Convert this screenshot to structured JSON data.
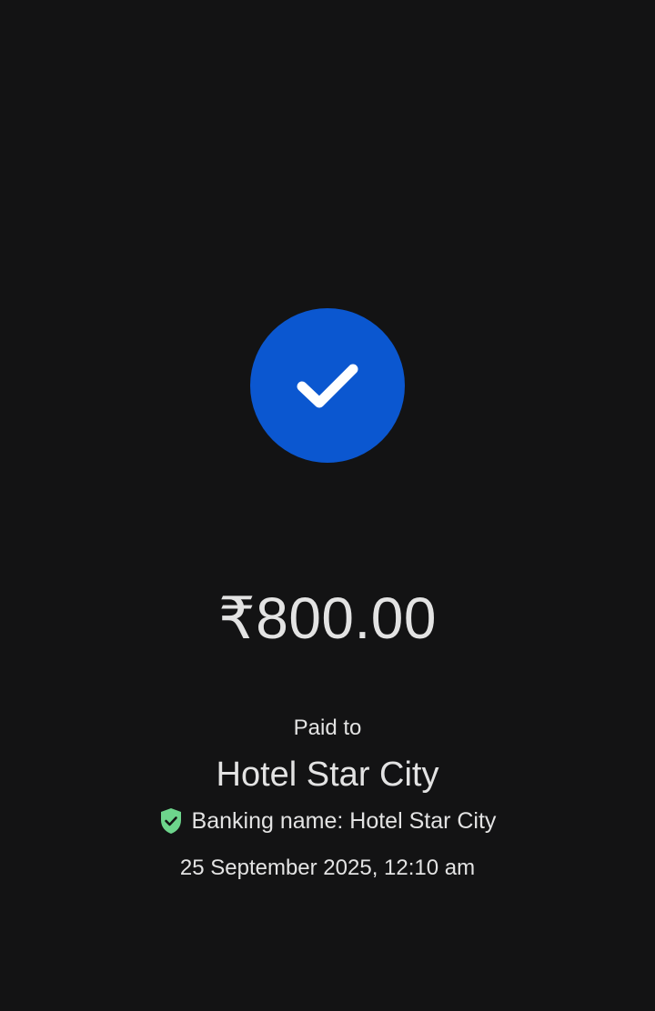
{
  "payment": {
    "amount": "₹800.00",
    "paid_to_label": "Paid to",
    "payee_name": "Hotel Star City",
    "banking_name": "Banking name: Hotel Star City",
    "timestamp": "25 September 2025, 12:10 am"
  },
  "icons": {
    "status": "check-icon",
    "verified": "verified-shield-icon"
  },
  "colors": {
    "background": "#131314",
    "success_circle": "#0b57d0",
    "verified_shield": "#6dd58c",
    "text": "#e3e3e3"
  }
}
